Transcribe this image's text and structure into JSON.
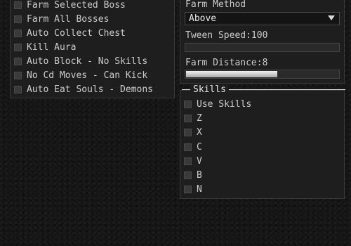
{
  "farm_options": [
    {
      "label": "Farm Selected Boss",
      "checked": false
    },
    {
      "label": "Farm All Bosses",
      "checked": false
    },
    {
      "label": "Auto Collect Chest",
      "checked": false
    },
    {
      "label": "Kill Aura",
      "checked": false
    },
    {
      "label": "Auto Block - No Skills",
      "checked": false
    },
    {
      "label": "No Cd Moves - Can Kick",
      "checked": false
    },
    {
      "label": "Auto Eat Souls - Demons",
      "checked": false
    }
  ],
  "settings": {
    "farm_method_label": "Farm Method",
    "farm_method_value": "Above",
    "tween_speed_label": "Tween Speed:100",
    "tween_speed_fraction": 0,
    "farm_distance_label": "Farm Distance:8",
    "farm_distance_fraction": 0.6
  },
  "skills": {
    "title": "Skills",
    "items": [
      {
        "label": "Use Skills",
        "checked": false
      },
      {
        "label": "Z",
        "checked": false
      },
      {
        "label": "X",
        "checked": false
      },
      {
        "label": "C",
        "checked": false
      },
      {
        "label": "V",
        "checked": false
      },
      {
        "label": "B",
        "checked": false
      },
      {
        "label": "N",
        "checked": false
      }
    ]
  },
  "colors": {
    "background": "#161616",
    "panel": "#1e1e1e",
    "checkbox": "#3a3a3a",
    "text": "#cdcdcd",
    "slider_fill": "#d0d0d0"
  }
}
